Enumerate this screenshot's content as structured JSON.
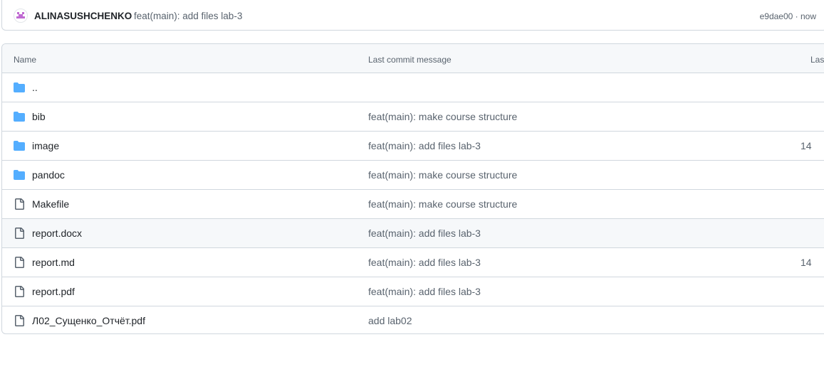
{
  "commit": {
    "author": "ALINASUSHCHENKO",
    "message": "feat(main): add files lab-3",
    "meta": "e9dae00 · now"
  },
  "table": {
    "headers": {
      "name": "Name",
      "message": "Last commit message",
      "date": "Las"
    },
    "rows": [
      {
        "name": "..",
        "icon": "folder-icon",
        "message": "",
        "date": ""
      },
      {
        "name": "bib",
        "icon": "folder-icon",
        "message": "feat(main): make course structure",
        "date": ""
      },
      {
        "name": "image",
        "icon": "folder-icon",
        "message": "feat(main): add files lab-3",
        "date": "14"
      },
      {
        "name": "pandoc",
        "icon": "folder-icon",
        "message": "feat(main): make course structure",
        "date": ""
      },
      {
        "name": "Makefile",
        "icon": "file-icon",
        "message": "feat(main): make course structure",
        "date": ""
      },
      {
        "name": "report.docx",
        "icon": "file-icon",
        "message": "feat(main): add files lab-3",
        "date": ""
      },
      {
        "name": "report.md",
        "icon": "file-icon",
        "message": "feat(main): add files lab-3",
        "date": "14"
      },
      {
        "name": "report.pdf",
        "icon": "file-icon",
        "message": "feat(main): add files lab-3",
        "date": ""
      },
      {
        "name": "Л02_Сущенко_Отчёт.pdf",
        "icon": "file-icon",
        "message": "add lab02",
        "date": ""
      }
    ]
  },
  "colors": {
    "folder": "#54aeff",
    "file": "#59636e",
    "avatar_accent": "#c06ad2"
  }
}
